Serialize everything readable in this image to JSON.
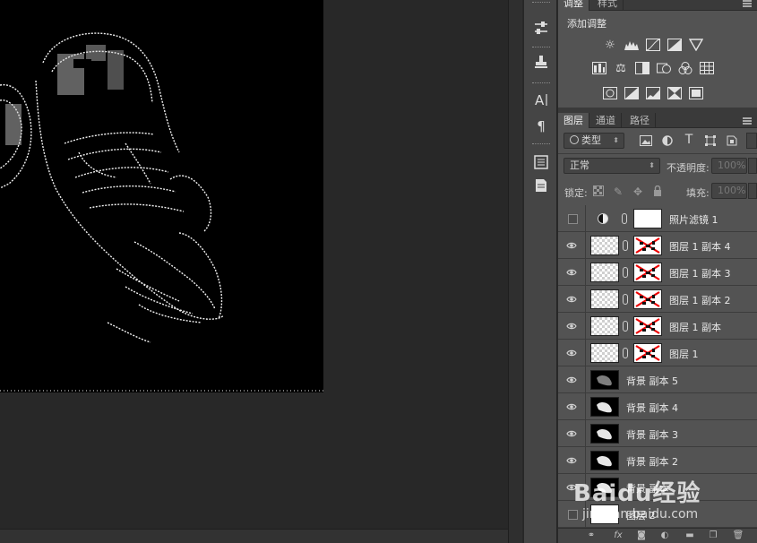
{
  "adjustments_panel": {
    "tabs": [
      "调整",
      "样式"
    ],
    "title": "添加调整",
    "icons_row1": [
      "brightness-contrast-icon",
      "levels-icon",
      "curves-icon",
      "exposure-icon",
      "vibrance-icon"
    ],
    "icons_row2": [
      "hue-saturation-icon",
      "color-balance-icon",
      "black-white-icon",
      "photo-filter-icon",
      "channel-mixer-icon",
      "color-lookup-icon"
    ],
    "icons_row3": [
      "invert-icon",
      "posterize-icon",
      "threshold-icon",
      "selective-color-icon",
      "gradient-map-icon"
    ]
  },
  "layers_panel": {
    "tabs": [
      "图层",
      "通道",
      "路径"
    ],
    "filter_label": "类型",
    "blend_mode": "正常",
    "opacity_label": "不透明度:",
    "opacity_value": "100%",
    "lock_label": "锁定:",
    "fill_label": "填充:",
    "fill_value": "100%",
    "layers": [
      {
        "name": "照片滤镜 1",
        "visible": false,
        "type": "adjustment"
      },
      {
        "name": "图层 1 副本 4",
        "visible": true,
        "type": "masked"
      },
      {
        "name": "图层 1 副本 3",
        "visible": true,
        "type": "masked"
      },
      {
        "name": "图层 1 副本 2",
        "visible": true,
        "type": "masked"
      },
      {
        "name": "图层 1 副本",
        "visible": true,
        "type": "masked"
      },
      {
        "name": "图层 1",
        "visible": true,
        "type": "masked"
      },
      {
        "name": "背景 副本 5",
        "visible": true,
        "type": "image"
      },
      {
        "name": "背景 副本 4",
        "visible": true,
        "type": "image"
      },
      {
        "name": "背景 副本 3",
        "visible": true,
        "type": "image"
      },
      {
        "name": "背景 副本 2",
        "visible": true,
        "type": "image"
      },
      {
        "name": "背景 副本",
        "visible": true,
        "type": "image"
      },
      {
        "name": "图层 2",
        "visible": false,
        "type": "white"
      }
    ]
  },
  "watermark": {
    "brand": "Baidu经验",
    "url": "jingyan.baidu.com"
  }
}
